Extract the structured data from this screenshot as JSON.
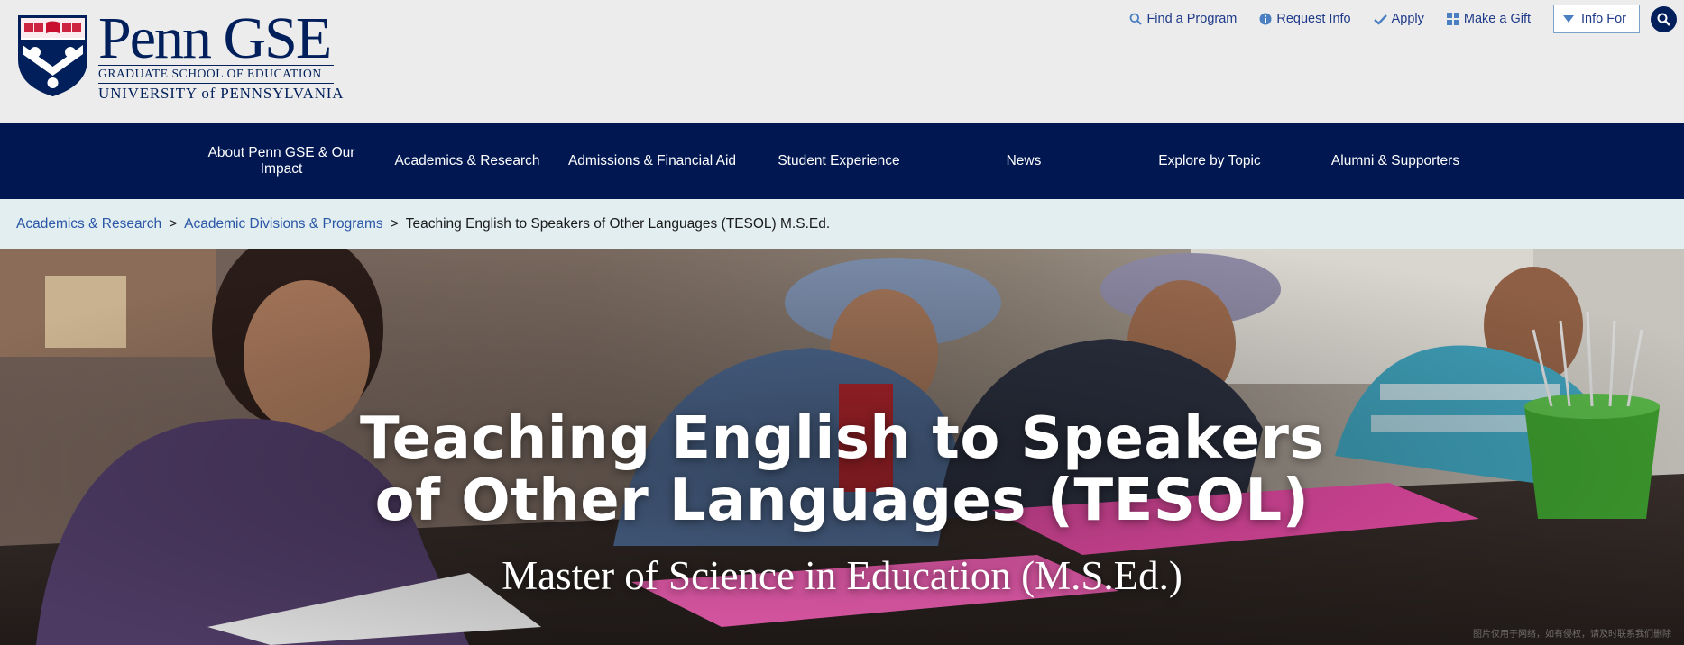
{
  "header": {
    "logo": {
      "main": "Penn GSE",
      "line1": "GRADUATE SCHOOL OF EDUCATION",
      "line2": "UNIVERSITY of PENNSYLVANIA"
    },
    "utility": {
      "find_program": "Find a Program",
      "request_info": "Request Info",
      "apply": "Apply",
      "make_gift": "Make a Gift",
      "info_for": "Info For"
    }
  },
  "nav": {
    "items": [
      {
        "label": "About Penn GSE & Our Impact"
      },
      {
        "label": "Academics & Research"
      },
      {
        "label": "Admissions & Financial Aid"
      },
      {
        "label": "Student Experience"
      },
      {
        "label": "News"
      },
      {
        "label": "Explore by Topic"
      },
      {
        "label": "Alumni & Supporters"
      }
    ]
  },
  "breadcrumb": {
    "items": [
      {
        "label": "Academics & Research"
      },
      {
        "label": "Academic Divisions & Programs"
      }
    ],
    "separator": ">",
    "current": "Teaching English to Speakers of Other Languages (TESOL) M.S.Ed."
  },
  "hero": {
    "title_line1": "Teaching English to Speakers",
    "title_line2": "of Other Languages (TESOL)",
    "subtitle": "Master of Science in Education (M.S.Ed.)",
    "watermark": "图片仅用于网络，如有侵权，请及时联系我们删除"
  },
  "colors": {
    "penn_blue": "#011F5B",
    "nav_bg": "#011752",
    "link_blue": "#2a56a6",
    "breadcrumb_bg": "#e2eef0"
  }
}
